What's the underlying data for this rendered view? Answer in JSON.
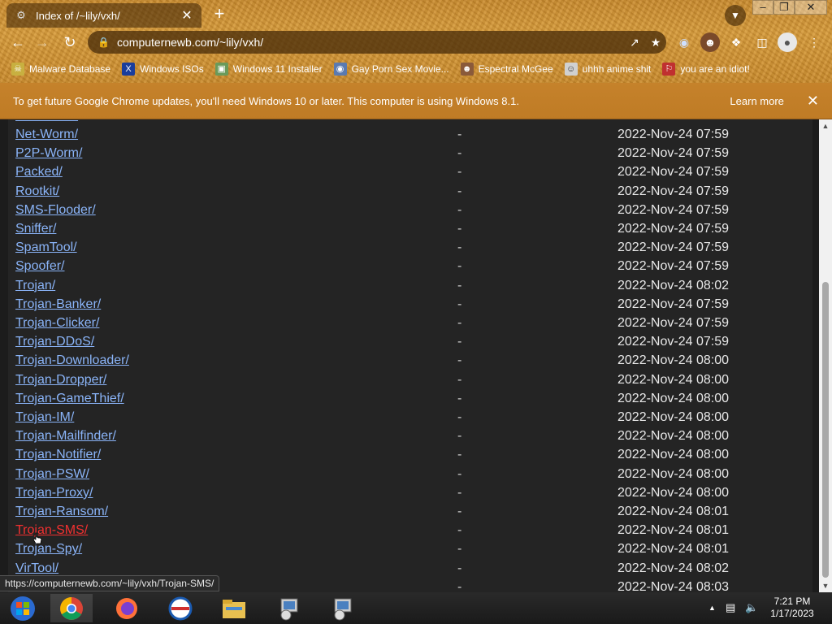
{
  "browser": {
    "tab_title": "Index of /~lily/vxh/",
    "url": "computernewb.com/~lily/vxh/",
    "bookmarks": [
      {
        "label": "Malware Database",
        "icon": "malware-icon",
        "color": "#c8b040"
      },
      {
        "label": "Windows ISOs",
        "icon": "x-icon",
        "color": "#1a3d9c"
      },
      {
        "label": "Windows 11 Installer",
        "icon": "image-icon",
        "color": "#6a9a5a"
      },
      {
        "label": "Gay Porn Sex Movie...",
        "icon": "globe-icon",
        "color": "#5a7ab0"
      },
      {
        "label": "Espectral McGee",
        "icon": "avatar-icon",
        "color": "#8a5a3a"
      },
      {
        "label": "uhhh anime shit",
        "icon": "anime-icon",
        "color": "#d0d0d0"
      },
      {
        "label": "you are an idiot!",
        "icon": "flag-icon",
        "color": "#c03030"
      }
    ],
    "infobar": {
      "message": "To get future Google Chrome updates, you'll need Windows 10 or later. This computer is using Windows 8.1.",
      "learn_more": "Learn more"
    },
    "status_url": "https://computernewb.com/~lily/vxh/Trojan-SMS/"
  },
  "listing": {
    "rows": [
      {
        "name": "Net-Worm/",
        "size": "-",
        "date": "2022-Nov-24 07:59"
      },
      {
        "name": "P2P-Worm/",
        "size": "-",
        "date": "2022-Nov-24 07:59"
      },
      {
        "name": "Packed/",
        "size": "-",
        "date": "2022-Nov-24 07:59"
      },
      {
        "name": "Rootkit/",
        "size": "-",
        "date": "2022-Nov-24 07:59"
      },
      {
        "name": "SMS-Flooder/",
        "size": "-",
        "date": "2022-Nov-24 07:59"
      },
      {
        "name": "Sniffer/",
        "size": "-",
        "date": "2022-Nov-24 07:59"
      },
      {
        "name": "SpamTool/",
        "size": "-",
        "date": "2022-Nov-24 07:59"
      },
      {
        "name": "Spoofer/",
        "size": "-",
        "date": "2022-Nov-24 07:59"
      },
      {
        "name": "Trojan/",
        "size": "-",
        "date": "2022-Nov-24 08:02"
      },
      {
        "name": "Trojan-Banker/",
        "size": "-",
        "date": "2022-Nov-24 07:59"
      },
      {
        "name": "Trojan-Clicker/",
        "size": "-",
        "date": "2022-Nov-24 07:59"
      },
      {
        "name": "Trojan-DDoS/",
        "size": "-",
        "date": "2022-Nov-24 07:59"
      },
      {
        "name": "Trojan-Downloader/",
        "size": "-",
        "date": "2022-Nov-24 08:00"
      },
      {
        "name": "Trojan-Dropper/",
        "size": "-",
        "date": "2022-Nov-24 08:00"
      },
      {
        "name": "Trojan-GameThief/",
        "size": "-",
        "date": "2022-Nov-24 08:00"
      },
      {
        "name": "Trojan-IM/",
        "size": "-",
        "date": "2022-Nov-24 08:00"
      },
      {
        "name": "Trojan-Mailfinder/",
        "size": "-",
        "date": "2022-Nov-24 08:00"
      },
      {
        "name": "Trojan-Notifier/",
        "size": "-",
        "date": "2022-Nov-24 08:00"
      },
      {
        "name": "Trojan-PSW/",
        "size": "-",
        "date": "2022-Nov-24 08:00"
      },
      {
        "name": "Trojan-Proxy/",
        "size": "-",
        "date": "2022-Nov-24 08:00"
      },
      {
        "name": "Trojan-Ransom/",
        "size": "-",
        "date": "2022-Nov-24 08:01"
      },
      {
        "name": "Trojan-SMS/",
        "size": "-",
        "date": "2022-Nov-24 08:01",
        "hovered": true
      },
      {
        "name": "Trojan-Spy/",
        "size": "-",
        "date": "2022-Nov-24 08:01"
      },
      {
        "name": "VirTool/",
        "size": "-",
        "date": "2022-Nov-24 08:02"
      },
      {
        "name": "",
        "size": "-",
        "date": "2022-Nov-24 08:03"
      }
    ],
    "link_color": "#8ab4f8",
    "hover_color": "#f23030"
  },
  "taskbar": {
    "apps": [
      "start-icon",
      "chrome-icon",
      "firefox-icon",
      "opera-icon",
      "file-explorer-icon",
      "installer-icon",
      "installer-icon"
    ],
    "time": "7:21 PM",
    "date": "1/17/2023"
  }
}
